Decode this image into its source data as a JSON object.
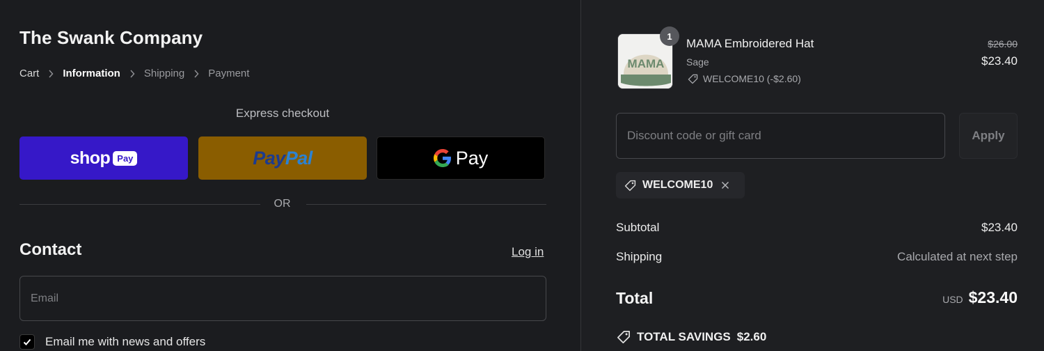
{
  "store": {
    "name": "The Swank Company"
  },
  "breadcrumb": [
    {
      "label": "Cart"
    },
    {
      "label": "Information"
    },
    {
      "label": "Shipping"
    },
    {
      "label": "Payment"
    }
  ],
  "express": {
    "label": "Express checkout",
    "shop_pay": {
      "word": "shop",
      "pill": "Pay"
    },
    "paypal": {
      "part1": "Pay",
      "part2": "Pal"
    },
    "gpay": {
      "word": "Pay"
    }
  },
  "divider": {
    "or_text": "OR"
  },
  "contact": {
    "heading": "Contact",
    "login_label": "Log in",
    "email_placeholder": "Email",
    "email_value": "",
    "newsletter_label": "Email me with news and offers",
    "newsletter_checked": true
  },
  "order": {
    "item": {
      "quantity": "1",
      "name": "MAMA Embroidered Hat",
      "variant": "Sage",
      "discount_note": "WELCOME10 (-$2.60)",
      "price_original": "$26.00",
      "price_final": "$23.40",
      "hat_text": "MAMA"
    },
    "discount_input_placeholder": "Discount code or gift card",
    "apply_label": "Apply",
    "applied_code": "WELCOME10",
    "subtotal_label": "Subtotal",
    "subtotal_value": "$23.40",
    "shipping_label": "Shipping",
    "shipping_value": "Calculated at next step",
    "total_label": "Total",
    "currency": "USD",
    "total_value": "$23.40",
    "savings_label": "TOTAL SAVINGS",
    "savings_value": "$2.60"
  },
  "colors": {
    "background": "#1b1c1f",
    "shop_pay": "#3618c8",
    "paypal": "#8a5d00",
    "gpay": "#000000"
  }
}
